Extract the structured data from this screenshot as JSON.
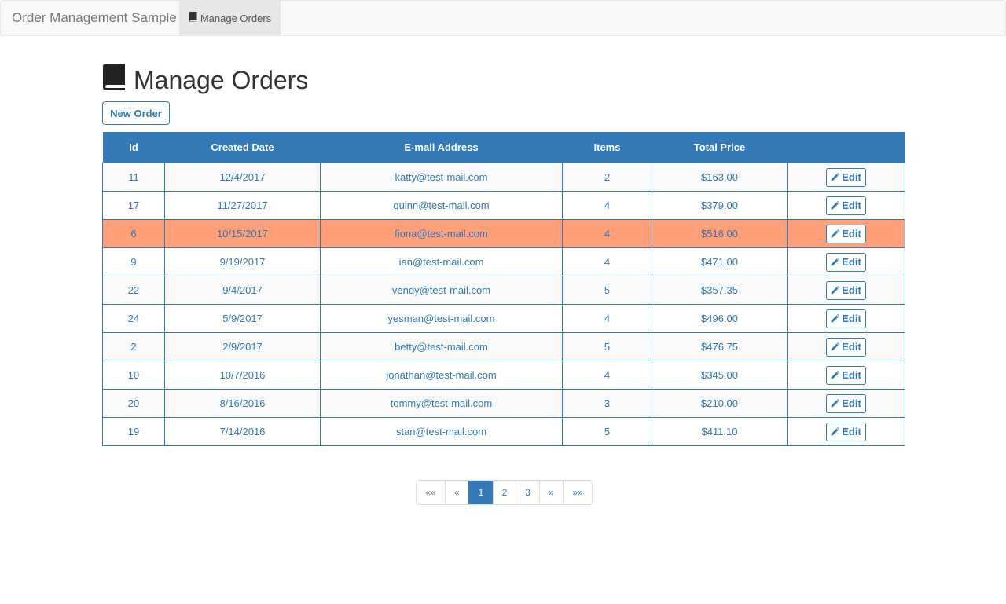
{
  "navbar": {
    "brand": "Order Management Sample",
    "items": [
      {
        "label": "Manage Orders",
        "icon": "book-icon"
      }
    ]
  },
  "page": {
    "title": "Manage Orders",
    "title_icon": "book-icon",
    "new_order_label": "New Order"
  },
  "table": {
    "headers": [
      "Id",
      "Created Date",
      "E-mail Address",
      "Items",
      "Total Price",
      ""
    ],
    "edit_label": "Edit",
    "rows": [
      {
        "id": "11",
        "date": "12/4/2017",
        "email": "katty@test-mail.com",
        "items": "2",
        "price": "$163.00"
      },
      {
        "id": "17",
        "date": "11/27/2017",
        "email": "quinn@test-mail.com",
        "items": "4",
        "price": "$379.00"
      },
      {
        "id": "6",
        "date": "10/15/2017",
        "email": "fiona@test-mail.com",
        "items": "4",
        "price": "$516.00",
        "highlighted": true
      },
      {
        "id": "9",
        "date": "9/19/2017",
        "email": "ian@test-mail.com",
        "items": "4",
        "price": "$471.00"
      },
      {
        "id": "22",
        "date": "9/4/2017",
        "email": "vendy@test-mail.com",
        "items": "5",
        "price": "$357.35"
      },
      {
        "id": "24",
        "date": "5/9/2017",
        "email": "yesman@test-mail.com",
        "items": "4",
        "price": "$496.00"
      },
      {
        "id": "2",
        "date": "2/9/2017",
        "email": "betty@test-mail.com",
        "items": "5",
        "price": "$476.75"
      },
      {
        "id": "10",
        "date": "10/7/2016",
        "email": "jonathan@test-mail.com",
        "items": "4",
        "price": "$345.00"
      },
      {
        "id": "20",
        "date": "8/16/2016",
        "email": "tommy@test-mail.com",
        "items": "3",
        "price": "$210.00"
      },
      {
        "id": "19",
        "date": "7/14/2016",
        "email": "stan@test-mail.com",
        "items": "5",
        "price": "$411.10"
      }
    ]
  },
  "pagination": {
    "first": "««",
    "prev": "«",
    "pages": [
      "1",
      "2",
      "3"
    ],
    "active": "1",
    "next": "»",
    "last": "»»"
  },
  "colors": {
    "primary": "#337ab7",
    "highlight_row": "#ffa07a",
    "navbar_bg": "#f8f8f8"
  }
}
